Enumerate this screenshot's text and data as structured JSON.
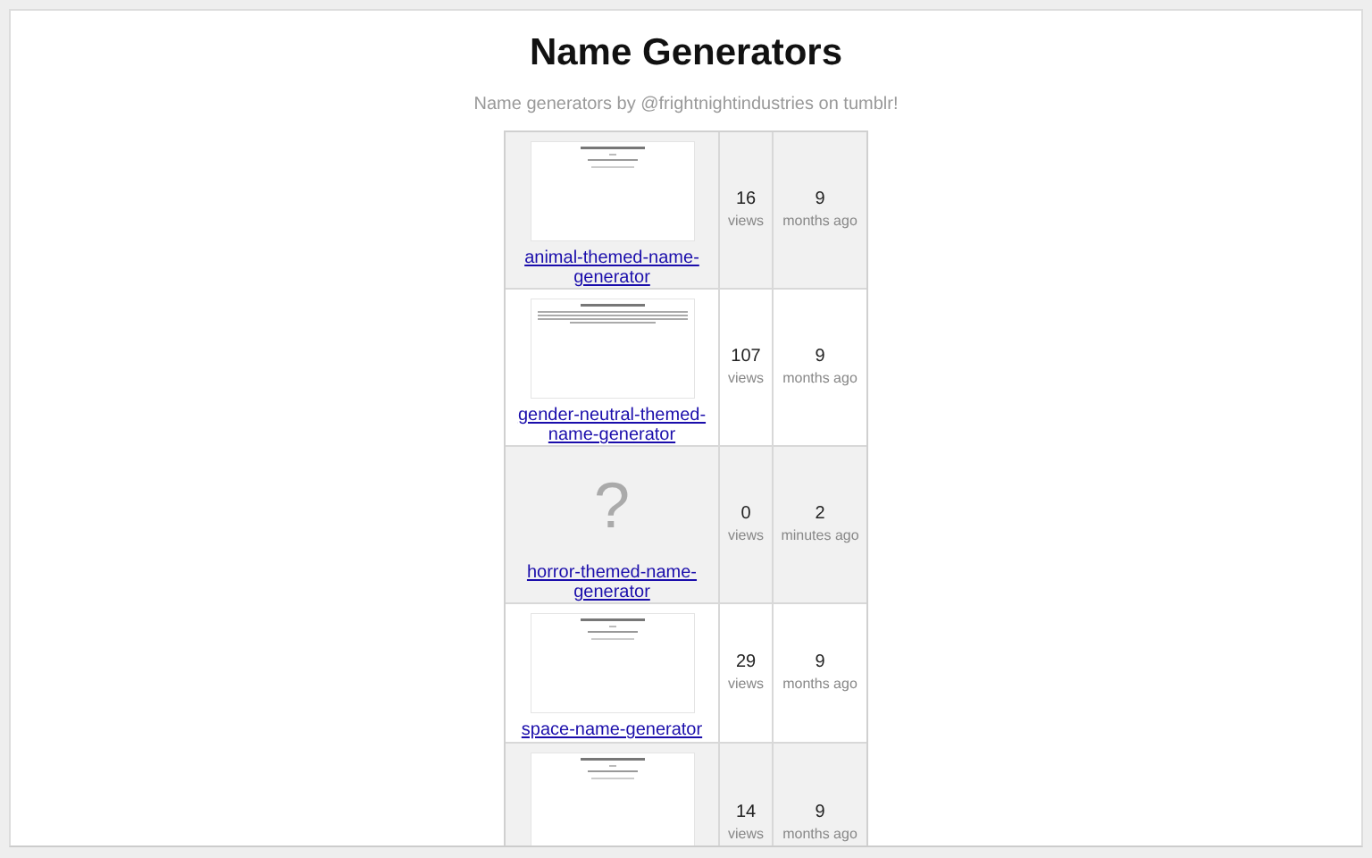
{
  "title": "Name Generators",
  "subtitle": "Name generators by @frightnightindustries on tumblr!",
  "rows": [
    {
      "thumbnail": {
        "kind": "preview"
      },
      "name": "animal-themed-name-generator",
      "views": "16",
      "views_label": "views",
      "age": "9",
      "age_label": "months ago"
    },
    {
      "thumbnail": {
        "kind": "preview_dense"
      },
      "name": "gender-neutral-themed-name-generator",
      "views": "107",
      "views_label": "views",
      "age": "9",
      "age_label": "months ago"
    },
    {
      "thumbnail": {
        "kind": "missing",
        "glyph": "?"
      },
      "name": "horror-themed-name-generator",
      "views": "0",
      "views_label": "views",
      "age": "2",
      "age_label": "minutes ago"
    },
    {
      "thumbnail": {
        "kind": "preview"
      },
      "name": "space-name-generator",
      "views": "29",
      "views_label": "views",
      "age": "9",
      "age_label": "months ago"
    },
    {
      "thumbnail": {
        "kind": "preview"
      },
      "views": "14",
      "views_label": "views",
      "age": "9",
      "age_label": "months ago"
    }
  ]
}
